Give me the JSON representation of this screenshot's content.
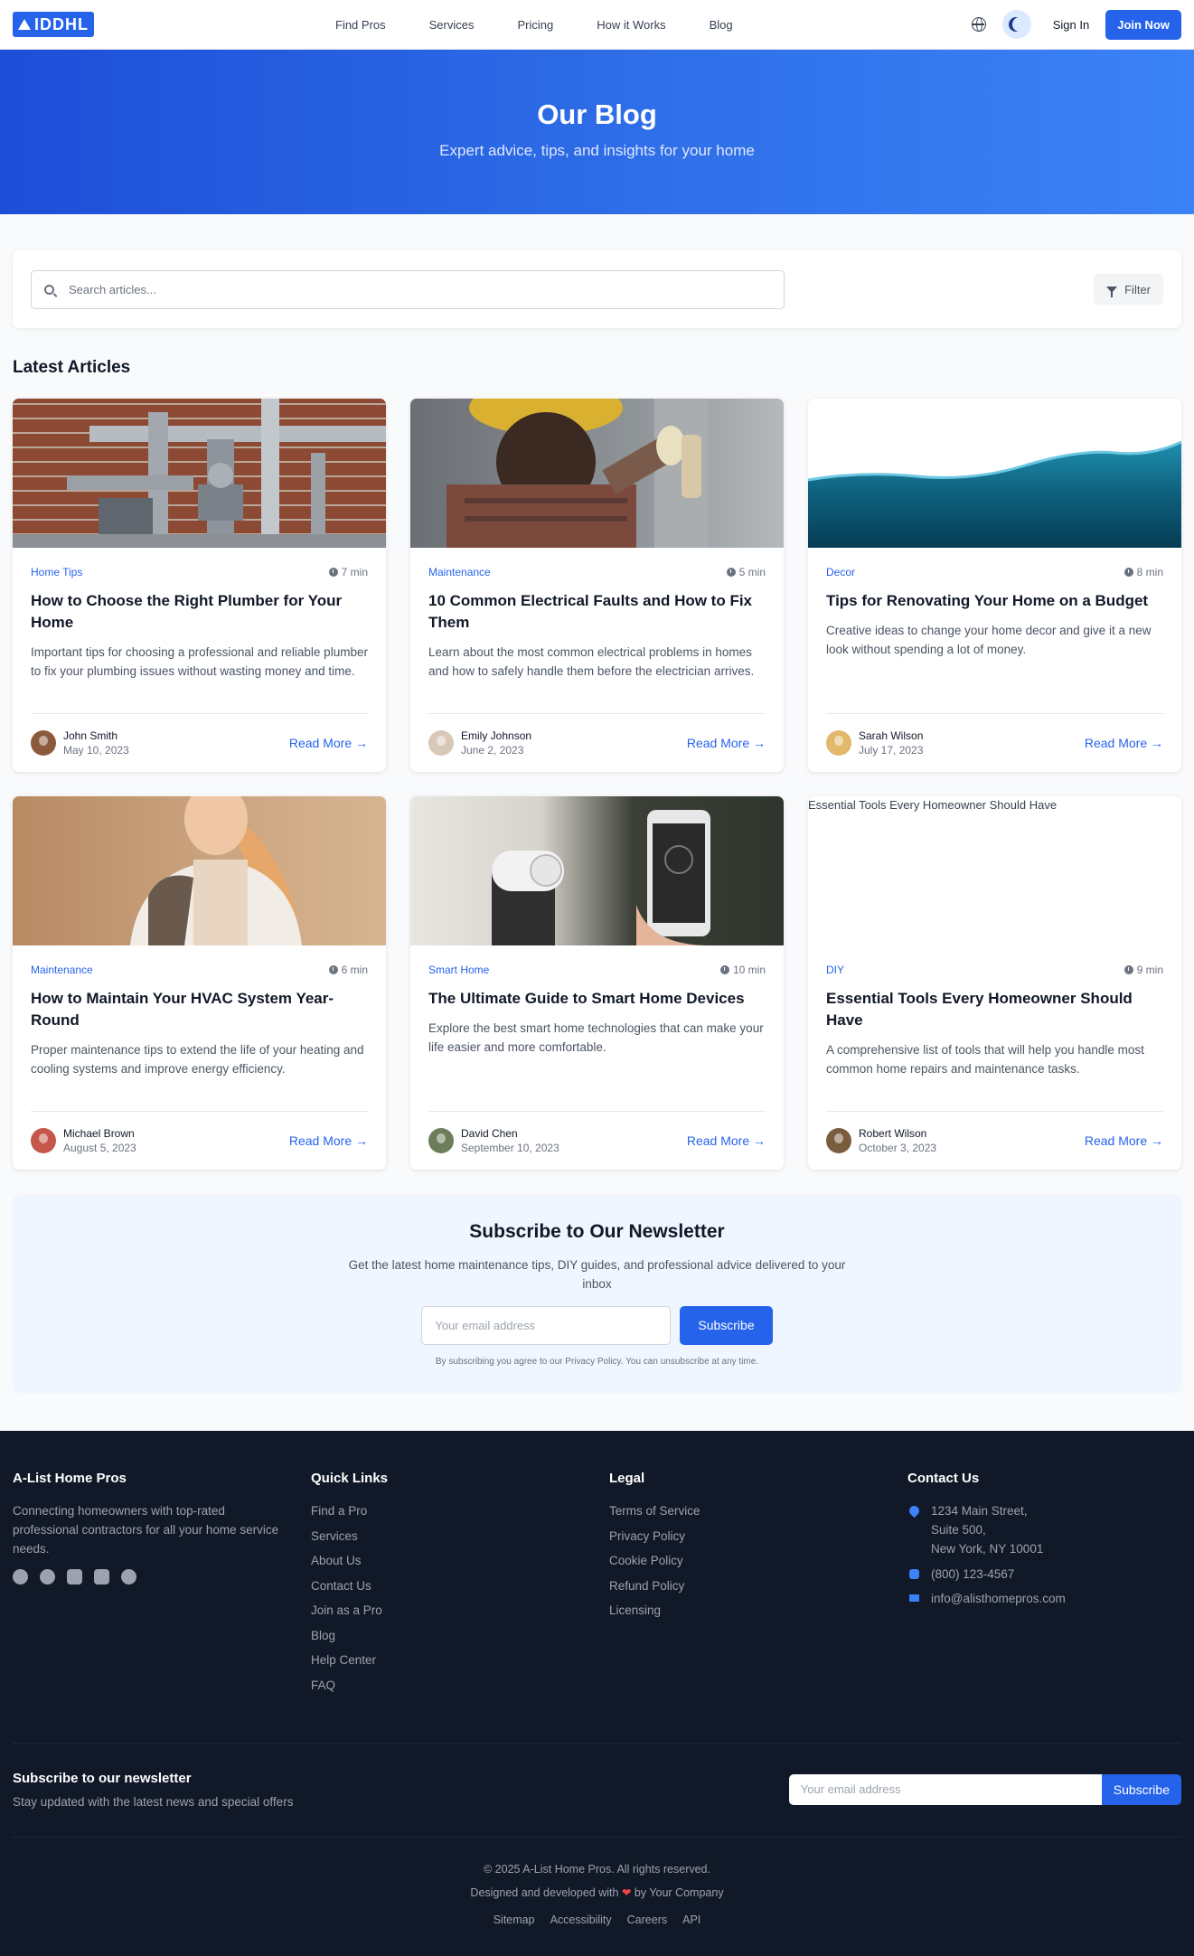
{
  "header": {
    "logo_text": "IDDHL",
    "nav": [
      "Find Pros",
      "Services",
      "Pricing",
      "How it Works",
      "Blog"
    ],
    "sign_in": "Sign In",
    "join": "Join Now"
  },
  "hero": {
    "title": "Our Blog",
    "subtitle": "Expert advice, tips, and insights for your home"
  },
  "search": {
    "placeholder": "Search articles...",
    "filter_label": "Filter"
  },
  "section_title": "Latest Articles",
  "articles": [
    {
      "category": "Home Tips",
      "read_time": "7 min",
      "title": "How to Choose the Right Plumber for Your Home",
      "excerpt": "Important tips for choosing a professional and reliable plumber to fix your plumbing issues without wasting money and time.",
      "author": "John Smith",
      "date": "May 10, 2023",
      "read_more": "Read More →"
    },
    {
      "category": "Maintenance",
      "read_time": "5 min",
      "title": "10 Common Electrical Faults and How to Fix Them",
      "excerpt": "Learn about the most common electrical problems in homes and how to safely handle them before the electrician arrives.",
      "author": "Emily Johnson",
      "date": "June 2, 2023",
      "read_more": "Read More →"
    },
    {
      "category": "Decor",
      "read_time": "8 min",
      "title": "Tips for Renovating Your Home on a Budget",
      "excerpt": "Creative ideas to change your home decor and give it a new look without spending a lot of money.",
      "author": "Sarah Wilson",
      "date": "July 17, 2023",
      "read_more": "Read More →"
    },
    {
      "category": "Maintenance",
      "read_time": "6 min",
      "title": "How to Maintain Your HVAC System Year-Round",
      "excerpt": "Proper maintenance tips to extend the life of your heating and cooling systems and improve energy efficiency.",
      "author": "Michael Brown",
      "date": "August 5, 2023",
      "read_more": "Read More →"
    },
    {
      "category": "Smart Home",
      "read_time": "10 min",
      "title": "The Ultimate Guide to Smart Home Devices",
      "excerpt": "Explore the best smart home technologies that can make your life easier and more comfortable.",
      "author": "David Chen",
      "date": "September 10, 2023",
      "read_more": "Read More →"
    },
    {
      "category": "DIY",
      "read_time": "9 min",
      "title": "Essential Tools Every Homeowner Should Have",
      "excerpt": "A comprehensive list of tools that will help you handle most common home repairs and maintenance tasks.",
      "author": "Robert Wilson",
      "date": "October 3, 2023",
      "read_more": "Read More →",
      "image_alt": "Essential Tools Every Homeowner Should Have"
    }
  ],
  "newsletter": {
    "title": "Subscribe to Our Newsletter",
    "subtitle": "Get the latest home maintenance tips, DIY guides, and professional advice delivered to your inbox",
    "placeholder": "Your email address",
    "button": "Subscribe",
    "note": "By subscribing you agree to our Privacy Policy. You can unsubscribe at any time."
  },
  "footer": {
    "brand": "A-List Home Pros",
    "tagline": "Connecting homeowners with top-rated professional contractors for all your home service needs.",
    "quick_links_title": "Quick Links",
    "quick_links": [
      "Find a Pro",
      "Services",
      "About Us",
      "Contact Us",
      "Join as a Pro",
      "Blog",
      "Help Center",
      "FAQ"
    ],
    "legal_title": "Legal",
    "legal": [
      "Terms of Service",
      "Privacy Policy",
      "Cookie Policy",
      "Refund Policy",
      "Licensing"
    ],
    "contact_title": "Contact Us",
    "address_line1": "1234 Main Street,",
    "address_line2": "Suite 500,",
    "address_line3": "New York, NY 10001",
    "phone": "(800) 123-4567",
    "email": "info@alisthomepros.com",
    "news_title": "Subscribe to our newsletter",
    "news_subtitle": "Stay updated with the latest news and special offers",
    "news_placeholder": "Your email address",
    "news_button": "Subscribe",
    "copyright": "© 2025 A-List Home Pros. All rights reserved.",
    "designed_prefix": "Designed and developed with",
    "designed_suffix": "by Your Company",
    "bottom_links": [
      "Sitemap",
      "Accessibility",
      "Careers",
      "API"
    ]
  },
  "colors": {
    "primary": "#2563eb",
    "footer_bg": "#111827",
    "hero_start": "#1d4ed8",
    "hero_end": "#3b82f6"
  }
}
